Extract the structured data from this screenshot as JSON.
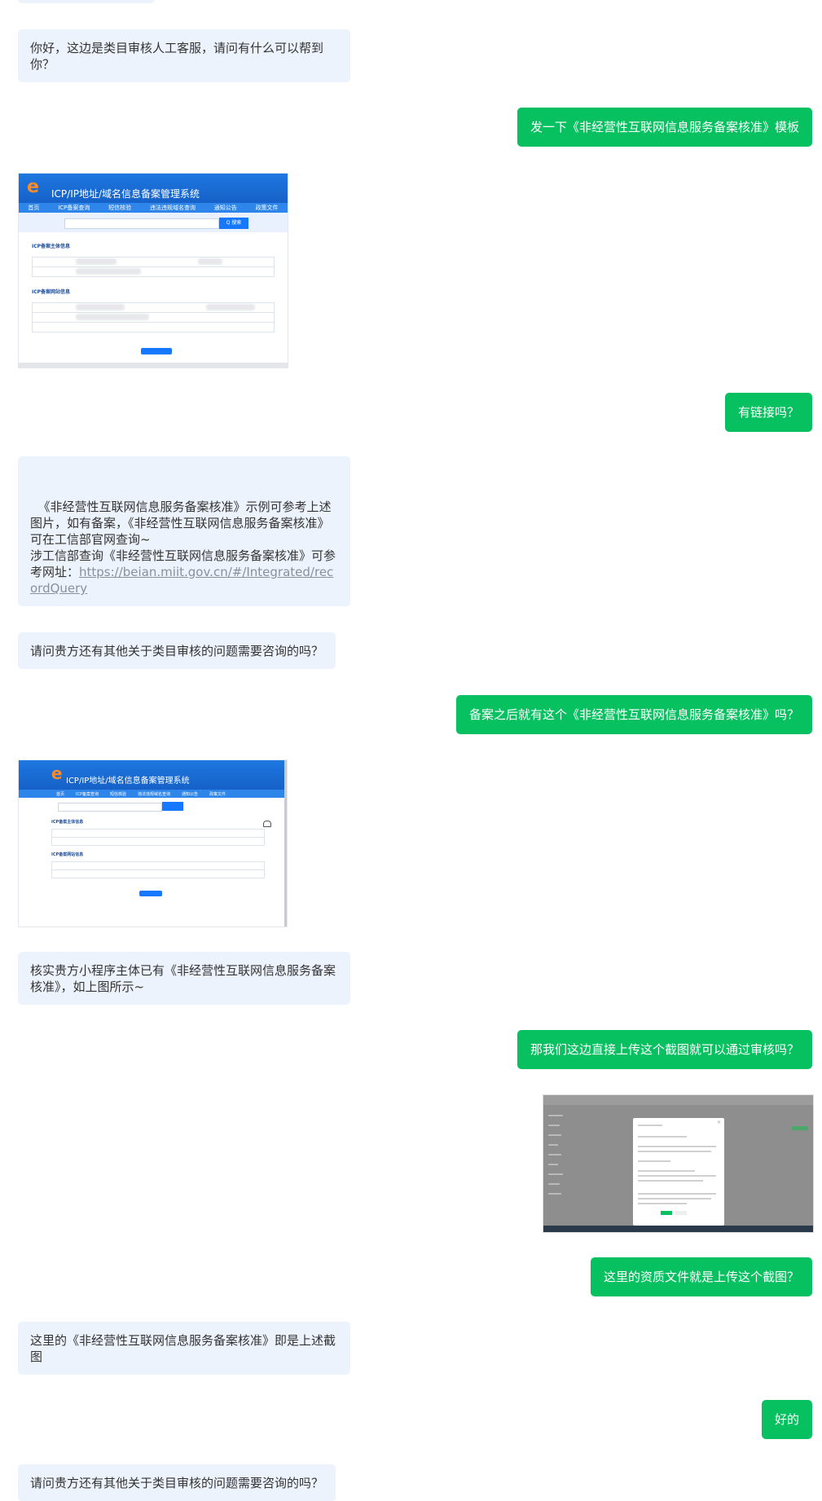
{
  "messages": {
    "m1": "你好，这边是类目审核人工客服，请问有什么可以帮到你？",
    "m2": "发一下《非经营性互联网信息服务备案核准》模板",
    "m4": "有链接吗？",
    "m5_text": "《非经营性互联网信息服务备案核准》示例可参考上述图片，如有备案，《非经营性互联网信息服务备案核准》可在工信部官网查询~\n涉工信部查询《非经营性互联网信息服务备案核准》可参考网址：",
    "m5_link": "https://beian.miit.gov.cn/#/Integrated/recordQuery",
    "m6": "请问贵方还有其他关于类目审核的问题需要咨询的吗？",
    "m7": "备案之后就有这个《非经营性互联网信息服务备案核准》吗？",
    "m9": "核实贵方小程序主体已有《非经营性互联网信息服务备案核准》，如上图所示~",
    "m10": "那我们这边直接上传这个截图就可以通过审核吗？",
    "m12": "这里的资质文件就是上传这个截图？",
    "m13": "这里的《非经营性互联网信息服务备案核准》即是上述截图",
    "m14": "好的",
    "m15": "请问贵方还有其他关于类目审核的问题需要咨询的吗？"
  },
  "screenshot1": {
    "system_name": "ICP/IP地址/域名信息备案管理系统",
    "search_button": "Q 搜索",
    "nav": [
      "首页",
      "ICP备案查询",
      "短信核验",
      "违法违规域名查询",
      "通知公告",
      "政策文件"
    ],
    "section1": "ICP备案主体信息",
    "section2": "ICP备案网站信息"
  },
  "screenshot2": {
    "system_name": "ICP/IP地址/域名信息备案管理系统",
    "nav": [
      "首页",
      "ICP备案查询",
      "短信核验",
      "违法违规域名查询",
      "通知公告",
      "政策文件"
    ],
    "section1": "ICP备案主体信息",
    "section2": "ICP备案网站信息"
  },
  "colors": {
    "user_bubble": "#07c160",
    "agent_bubble": "#edf3fc",
    "miit_blue": "#1677ff"
  }
}
